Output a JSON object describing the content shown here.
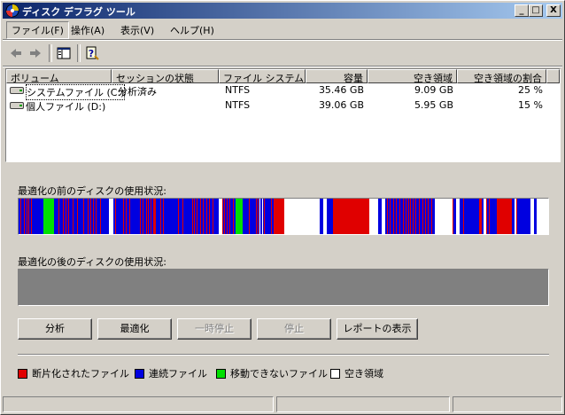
{
  "window": {
    "title": "ディスク デフラグ ツール"
  },
  "titlebar_buttons": {
    "minimize": "_",
    "maximize": "□",
    "close": "X"
  },
  "menu": [
    "ファイル(F)",
    "操作(A)",
    "表示(V)",
    "ヘルプ(H)"
  ],
  "volumes": {
    "columns": [
      "ボリューム",
      "セッションの状態",
      "ファイル システム",
      "容量",
      "空き領域",
      "空き領域の割合"
    ],
    "rows": [
      {
        "name": "システムファイル (C:)",
        "status": "分析済み",
        "fs": "NTFS",
        "capacity": "35.46 GB",
        "free": "9.09 GB",
        "percent": "25 %"
      },
      {
        "name": "個人ファイル (D:)",
        "status": "",
        "fs": "NTFS",
        "capacity": "39.06 GB",
        "free": "5.95 GB",
        "percent": "15 %"
      }
    ]
  },
  "analysis": {
    "before_label": "最適化の前のディスクの使用状況:",
    "after_label": "最適化の後のディスクの使用状況:"
  },
  "buttons": {
    "analyze": "分析",
    "defragment": "最適化",
    "pause": "一時停止",
    "stop": "停止",
    "report": "レポートの表示"
  },
  "legend": [
    {
      "label": "断片化されたファイル",
      "color": "#e00000"
    },
    {
      "label": "連続ファイル",
      "color": "#0000e0"
    },
    {
      "label": "移動できないファイル",
      "color": "#00e000"
    },
    {
      "label": "空き領域",
      "color": "#ffffff"
    }
  ],
  "colors": {
    "fragmented": "#e00000",
    "contiguous": "#0000e0",
    "unmovable": "#00e000",
    "free": "#ffffff"
  }
}
